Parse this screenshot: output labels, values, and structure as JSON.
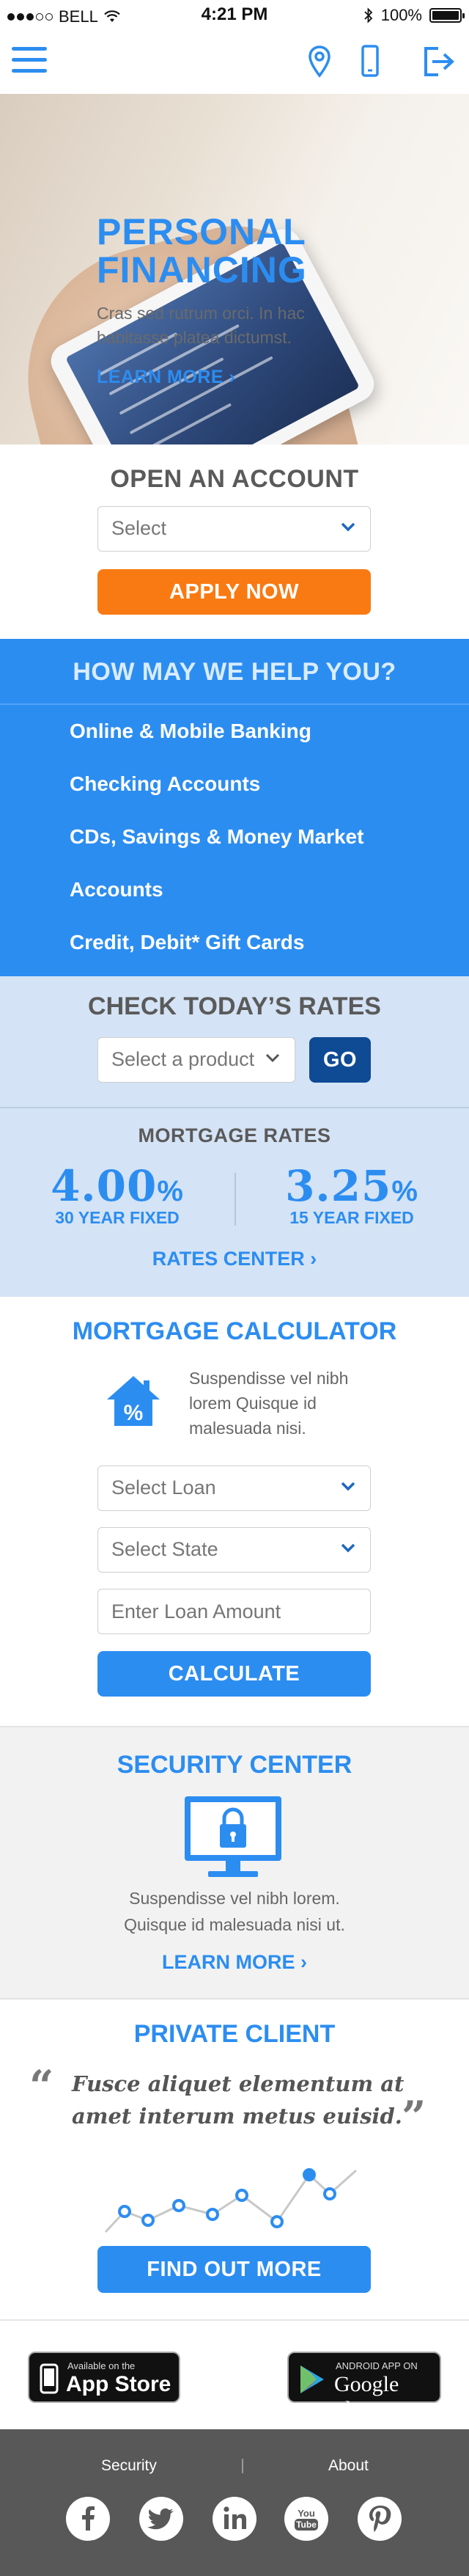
{
  "status_bar": {
    "carrier": "BELL",
    "time": "4:21 PM",
    "battery": "100%",
    "battery_level": 1.0
  },
  "nav": {
    "menu_icon": "hamburger-menu-icon",
    "location_icon": "map-pin-icon",
    "mobile_icon": "smartphone-icon",
    "signin_icon": "sign-in-icon"
  },
  "hero": {
    "title_line1": "PERSONAL",
    "title_line2": "FINANCING",
    "body": "Cras sed rutrum orci. In hac habitasse platea dictumst.",
    "link": "LEARN MORE ›",
    "slides": 5,
    "active_slide": 1
  },
  "open_account": {
    "title": "OPEN AN ACCOUNT",
    "select_placeholder": "Select",
    "apply_label": "APPLY NOW"
  },
  "help": {
    "title": "HOW MAY WE HELP YOU?",
    "items": [
      "Online & Mobile Banking",
      "Checking Accounts",
      "CDs, Savings & Money Market",
      "Accounts",
      "Credit, Debit* Gift Cards"
    ]
  },
  "rates": {
    "title": "CHECK TODAY’S RATES",
    "select_placeholder": "Select a product",
    "go_label": "GO",
    "mortgage_title": "MORTGAGE RATES",
    "rate1_value": "4.00",
    "rate1_unit": "%",
    "rate1_label": "30 YEAR FIXED",
    "rate2_value": "3.25",
    "rate2_unit": "%",
    "rate2_label": "15 YEAR FIXED",
    "center_link": "RATES CENTER ›"
  },
  "calculator": {
    "title": "MORTGAGE CALCULATOR",
    "description": "Suspendisse vel nibh lorem Quisque id malesuada nisi.",
    "select_loan": "Select Loan",
    "select_state": "Select State",
    "loan_amount_placeholder": "Enter Loan Amount",
    "calculate_label": "CALCULATE"
  },
  "security": {
    "title": "SECURITY CENTER",
    "description_line1": "Suspendisse vel nibh lorem.",
    "description_line2": "Quisque id malesuada nisi ut.",
    "link": "LEARN MORE ›"
  },
  "private_client": {
    "title": "PRIVATE CLIENT",
    "quote": "Fusce aliquet elementum at amet interum metus euisid.",
    "open_quote": "“",
    "close_quote": "”",
    "button_label": "FIND OUT MORE"
  },
  "apps": {
    "appstore_small": "Available on the",
    "appstore_big": "App Store",
    "google_small": "ANDROID APP ON",
    "google_big": "Google play"
  },
  "footer": {
    "link1": "Security",
    "link2": "About",
    "social": [
      "facebook-icon",
      "twitter-icon",
      "linkedin-icon",
      "youtube-icon",
      "pinterest-icon"
    ],
    "youtube_text": "You Tube"
  },
  "colors": {
    "brand_blue": "#2c8df1",
    "accent_orange": "#f97a12",
    "dark_blue": "#0f4a95",
    "light_blue_bg": "#d4e3f5",
    "footer_gray": "#585858"
  }
}
